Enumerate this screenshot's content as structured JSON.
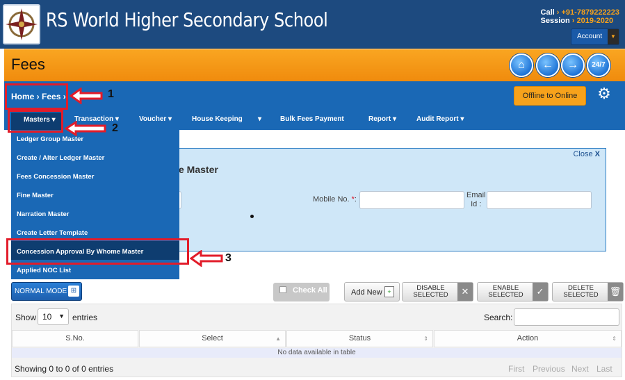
{
  "header": {
    "school_name": "RS World Higher Secondary School",
    "call_label": "Call",
    "call_value": "+91-7879222223",
    "session_label": "Session",
    "session_value": "2019-2020",
    "account_label": "Account"
  },
  "title_bar": {
    "title": "Fees",
    "support_label": "24/7"
  },
  "breadcrumb": {
    "home": "Home",
    "current": "Fees"
  },
  "offline_button": "Offline to Online",
  "menu": {
    "items": [
      "Masters",
      "Transaction",
      "Voucher",
      "House Keeping",
      "Bulk Fees Payment",
      "Report",
      "Audit Report"
    ]
  },
  "dropdown": {
    "items": [
      "Ledger Group Master",
      "Create / Alter Ledger Master",
      "Fees Concession Master",
      "Fine Master",
      "Narration Master",
      "Create Letter Template",
      "Concession Approval By Whome Master",
      "Applied NOC List"
    ]
  },
  "form": {
    "close_label": "Close",
    "close_x": "X",
    "heading_fragment": "e Master",
    "mobile_label": "Mobile No.",
    "required_mark": "*",
    "email_label_1": "Email",
    "email_label_2": "Id :"
  },
  "toolbar": {
    "normal_mode": "NORMAL MODE",
    "check_all": "Check All",
    "add_new": "Add New",
    "disable_1": "DISABLE",
    "disable_2": "SELECTED",
    "enable_1": "ENABLE",
    "enable_2": "SELECTED",
    "delete_1": "DELETE",
    "delete_2": "SELECTED"
  },
  "table": {
    "show_label": "Show",
    "entries_value": "10",
    "entries_label": "entries",
    "search_label": "Search:",
    "columns": [
      "S.No.",
      "Select",
      "Status",
      "Action"
    ],
    "empty_message": "No data available in table",
    "info": "Showing 0 to 0 of 0 entries",
    "pager": [
      "First",
      "Previous",
      "Next",
      "Last"
    ]
  },
  "annotations": [
    "1",
    "2",
    "3"
  ],
  "colors": {
    "header_bg": "#1d4a7f",
    "title_bar": "#f39a17",
    "nav_bar": "#1a68b5",
    "accent_orange": "#f7a21b",
    "annotation_red": "#e21c2a"
  }
}
